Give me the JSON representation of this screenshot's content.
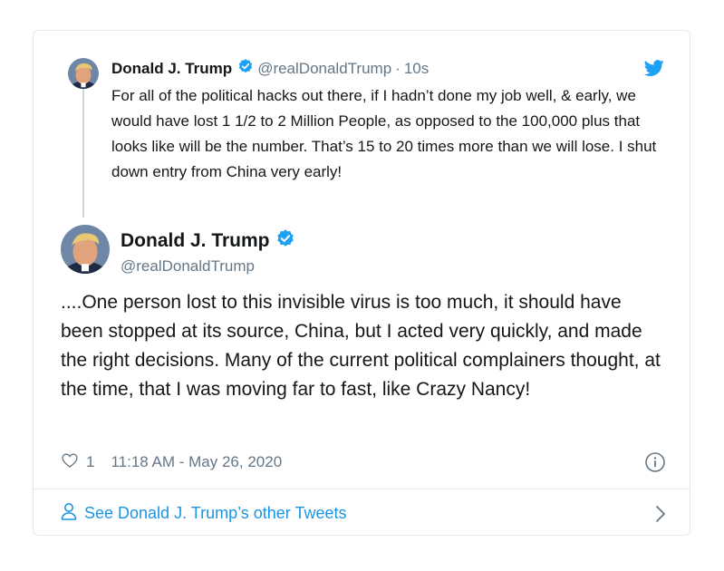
{
  "quoted_tweet": {
    "display_name": "Donald J. Trump",
    "handle": "@realDonaldTrump",
    "separator": "·",
    "time": "10s",
    "text": "For all of the political hacks out there, if I hadn’t done my job well, & early, we would have lost 1 1/2 to 2 Million People, as opposed to the 100,000 plus that looks like will be the number. That’s 15 to 20 times more than we will lose. I shut down entry from China very early!"
  },
  "main_tweet": {
    "display_name": "Donald J. Trump",
    "handle": "@realDonaldTrump",
    "text": "....One person lost to this invisible virus is too much, it should have been stopped at its source, China, but I acted very quickly, and made the right decisions. Many of the current political complainers thought, at the time, that I was moving far to fast, like Crazy Nancy!",
    "like_count": "1",
    "timestamp": "11:18 AM - May 26, 2020"
  },
  "footer": {
    "link_text": "See Donald J. Trump’s other Tweets"
  },
  "icons": {
    "verified": "verified-badge-icon",
    "bird": "twitter-bird-icon",
    "like": "heart-icon",
    "info": "info-icon",
    "person": "person-icon",
    "chevron": "chevron-right-icon"
  },
  "colors": {
    "accent": "#1da1f2",
    "link": "#1b95e0",
    "secondary_text": "#657786",
    "border": "#e1e8ed"
  }
}
